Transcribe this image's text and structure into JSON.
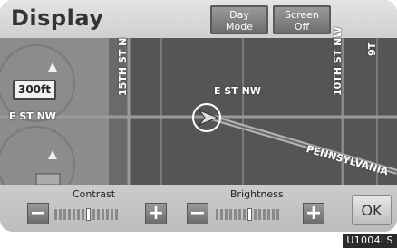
{
  "header": {
    "title": "Display",
    "day_mode_label": "Day\nMode",
    "screen_off_label": "Screen\nOff"
  },
  "map": {
    "scale": "300ft",
    "streets": {
      "e_st_nw_left": "E ST NW",
      "e_st_nw_center": "E ST NW",
      "fifteenth": "15TH ST N",
      "tenth": "10TH ST NW",
      "ninth": "9T",
      "pennsylvania": "PENNSYLVANIA"
    }
  },
  "controls": {
    "contrast": {
      "label": "Contrast",
      "minus": "−",
      "plus": "+",
      "level_fraction": 0.5
    },
    "brightness": {
      "label": "Brightness",
      "minus": "−",
      "plus": "+",
      "level_fraction": 0.5
    },
    "ok_label": "OK"
  },
  "figure_code": "U1004LS"
}
